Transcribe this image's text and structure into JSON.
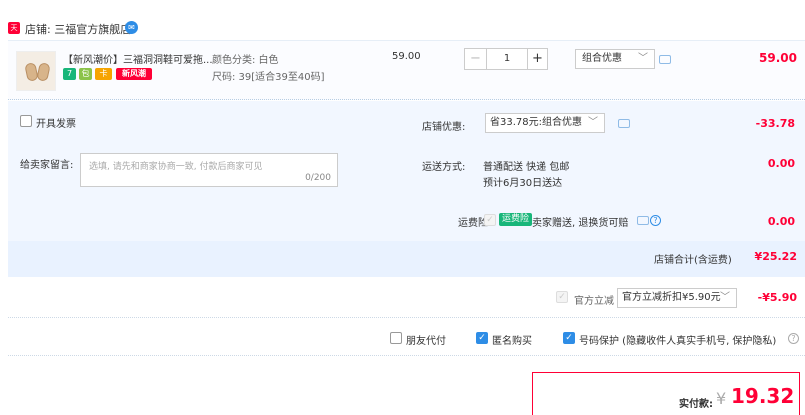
{
  "shop": {
    "icon_text": "天猫",
    "label": "店铺: 三福官方旗舰店",
    "im_icon": "chat-bubble-icon"
  },
  "item": {
    "title": "【新风潮价】三福洞洞鞋可爱拖...",
    "badges": [
      "7",
      "包",
      "卡",
      "新风潮"
    ],
    "color": "颜色分类: 白色",
    "size": "尺码: 39[适合39至40码]",
    "unit_price": "59.00",
    "quantity": "1",
    "promo_select": "组合优惠",
    "total": "59.00"
  },
  "invoice": {
    "label": "开具发票"
  },
  "message": {
    "label": "给卖家留言:",
    "placeholder": "选填, 请先和商家协商一致, 付款后商家可见",
    "count": "0/200"
  },
  "shop_discount": {
    "label": "店铺优惠:",
    "select": "省33.78元:组合优惠",
    "amount": "-33.78"
  },
  "delivery": {
    "label": "运送方式:",
    "method": "普通配送 快递 包邮",
    "eta": "预计6月30日送达",
    "amount": "0.00"
  },
  "insurance": {
    "label": "运费险:",
    "tag": "运费险",
    "desc": "卖家赠送, 退换货可赔",
    "amount": "0.00"
  },
  "shop_total": {
    "label": "店铺合计(含运费)",
    "amount": "¥25.22"
  },
  "official_discount": {
    "label": "官方立减",
    "select": "官方立减折扣¥5.90元",
    "amount": "-¥5.90"
  },
  "options": {
    "friend_pay": "朋友代付",
    "anonymous": "匿名购买",
    "number_protect": "号码保护 (隐藏收件人真实手机号, 保护隐私)"
  },
  "payment": {
    "label": "实付款:",
    "currency": "¥",
    "amount": "19.32"
  },
  "colors": {
    "accent_red": "#ff0036",
    "accent_blue": "#2e8de6"
  }
}
